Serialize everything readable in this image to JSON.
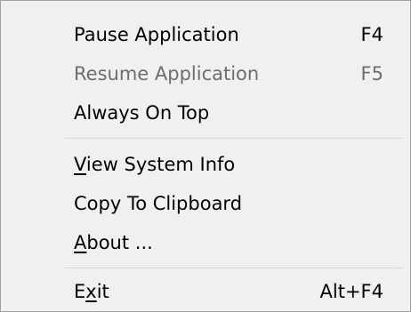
{
  "menu": {
    "items": [
      {
        "label": "Pause Application",
        "shortcut": "F4",
        "enabled": true
      },
      {
        "label": "Resume Application",
        "shortcut": "F5",
        "enabled": false
      },
      {
        "label": "Always On Top",
        "shortcut": "",
        "enabled": true
      },
      {
        "label_pre": "",
        "label_mnemonic": "V",
        "label_post": "iew System Info",
        "shortcut": "",
        "enabled": true
      },
      {
        "label": "Copy To Clipboard",
        "shortcut": "",
        "enabled": true
      },
      {
        "label_pre": "",
        "label_mnemonic": "A",
        "label_post": "bout ...",
        "shortcut": "",
        "enabled": true
      },
      {
        "label_pre": "E",
        "label_mnemonic": "x",
        "label_post": "it",
        "shortcut": "Alt+F4",
        "enabled": true
      }
    ]
  },
  "colors": {
    "background": "#f0f0f0",
    "text": "#000000",
    "disabled_text": "#6d6d6d",
    "separator": "#d6d6d6",
    "border": "#a0a0a0"
  }
}
